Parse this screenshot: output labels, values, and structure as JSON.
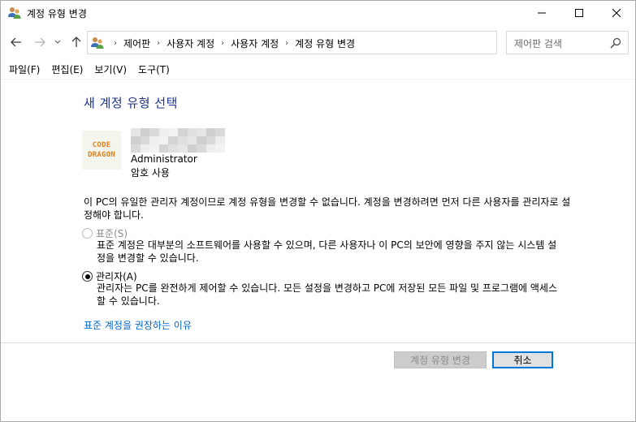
{
  "window": {
    "title": "계정 유형 변경",
    "icon": "user-accounts-icon"
  },
  "address": {
    "breadcrumbs": [
      "제어판",
      "사용자 계정",
      "사용자 계정",
      "계정 유형 변경"
    ],
    "search_placeholder": "제어판 검색"
  },
  "menu": {
    "items": [
      "파일(F)",
      "편집(E)",
      "보기(V)",
      "도구(T)"
    ]
  },
  "content": {
    "heading": "새 계정 유형 선택",
    "avatar_text": [
      "CODE",
      "DRAGON"
    ],
    "account_role": "Administrator",
    "account_password": "암호 사용",
    "description": "이 PC의 유일한 관리자 계정이므로 계정 유형을 변경할 수 없습니다. 계정을 변경하려면 먼저 다른 사용자를 관리자로 설정해야 합니다.",
    "options": [
      {
        "label": "표준(S)",
        "selected": false,
        "enabled": false,
        "description": "표준 계정은 대부분의 소프트웨어를 사용할 수 있으며, 다른 사용자나 이 PC의 보안에 영향을 주지 않는 시스템 설정을 변경할 수 있습니다."
      },
      {
        "label": "관리자(A)",
        "selected": true,
        "enabled": true,
        "description": "관리자는 PC를 완전하게 제어할 수 있습니다. 모든 설정을 변경하고 PC에 저장된 모든 파일 및 프로그램에 액세스할 수 있습니다."
      }
    ],
    "link": "표준 계정을 권장하는 이유"
  },
  "buttons": {
    "change": "계정 유형 변경",
    "cancel": "취소"
  },
  "colors": {
    "heading": "#1e3287",
    "link": "#0066cc",
    "accent": "#0078d7"
  }
}
